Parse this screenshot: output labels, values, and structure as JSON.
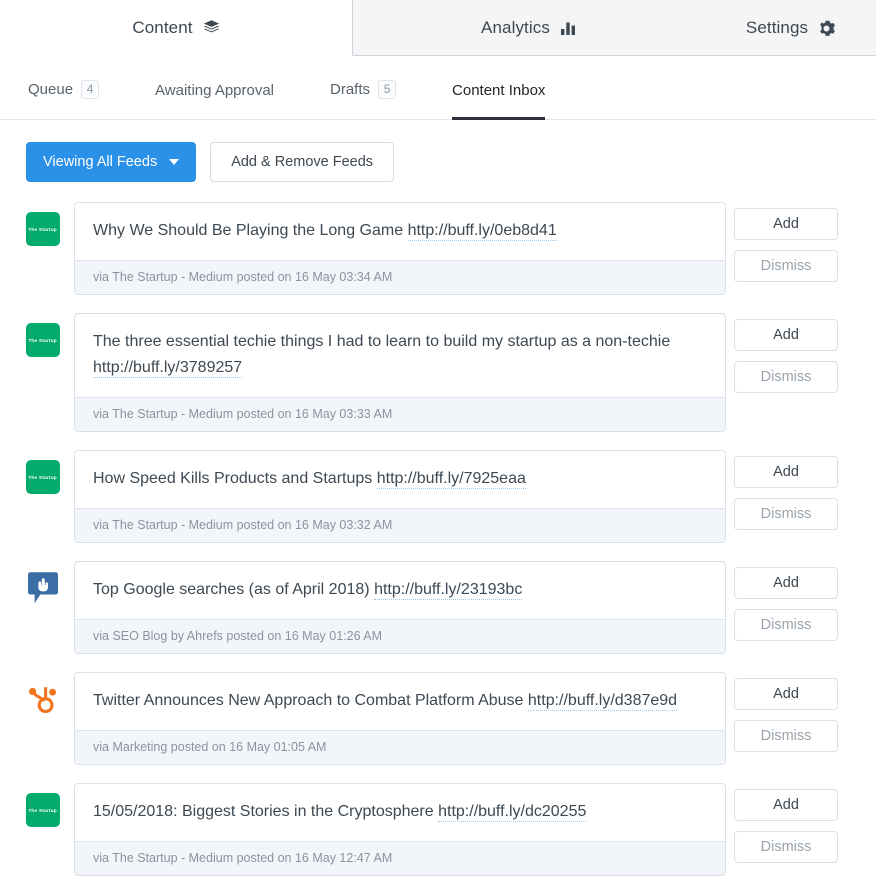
{
  "topnav": {
    "items": [
      {
        "label": "Content",
        "icon": "layers-icon",
        "active": true
      },
      {
        "label": "Analytics",
        "icon": "bar-chart-icon",
        "active": false
      },
      {
        "label": "Settings",
        "icon": "gear-icon",
        "active": false
      }
    ]
  },
  "subnav": {
    "items": [
      {
        "label": "Queue",
        "badge": "4"
      },
      {
        "label": "Awaiting Approval",
        "badge": ""
      },
      {
        "label": "Drafts",
        "badge": "5"
      },
      {
        "label": "Content Inbox",
        "badge": ""
      }
    ],
    "active": "Content Inbox"
  },
  "filterbar": {
    "viewing_label": "Viewing All Feeds",
    "add_remove_label": "Add & Remove Feeds"
  },
  "actions": {
    "add_label": "Add",
    "dismiss_label": "Dismiss"
  },
  "colors": {
    "primary_blue": "#2a90e8",
    "medium_green": "#00ab6b",
    "ahrefs_blue": "#3a6ea5",
    "hubspot_orange": "#f2741f",
    "active_tab_underline": "#2c3038",
    "meta_background": "#f2f5f9"
  },
  "feed": {
    "items": [
      {
        "avatar": "the-startup-logo",
        "avatar_text": "The Startup",
        "title": "Why We Should Be Playing the Long Game",
        "url": "http://buff.ly/0eb8d41",
        "meta": "via The Startup - Medium posted on 16 May 03:34 AM"
      },
      {
        "avatar": "the-startup-logo",
        "avatar_text": "The Startup",
        "title": "The three essential techie things I had to learn to build my startup as a non-techie",
        "url": "http://buff.ly/3789257",
        "meta": "via The Startup - Medium posted on 16 May 03:33 AM"
      },
      {
        "avatar": "the-startup-logo",
        "avatar_text": "The Startup",
        "title": "How Speed Kills Products and Startups",
        "url": "http://buff.ly/7925eaa",
        "meta": "via The Startup - Medium posted on 16 May 03:32 AM"
      },
      {
        "avatar": "ahrefs-logo",
        "avatar_text": "",
        "title": "Top Google searches (as of April 2018)",
        "url": "http://buff.ly/23193bc",
        "meta": "via SEO Blog by Ahrefs posted on 16 May 01:26 AM"
      },
      {
        "avatar": "hubspot-logo",
        "avatar_text": "",
        "title": "Twitter Announces New Approach to Combat Platform Abuse",
        "url": "http://buff.ly/d387e9d",
        "meta": "via Marketing posted on 16 May 01:05 AM"
      },
      {
        "avatar": "the-startup-logo",
        "avatar_text": "The Startup",
        "title": "15/05/2018: Biggest Stories in the Cryptosphere",
        "url": "http://buff.ly/dc20255",
        "meta": "via The Startup - Medium posted on 16 May 12:47 AM"
      }
    ]
  }
}
